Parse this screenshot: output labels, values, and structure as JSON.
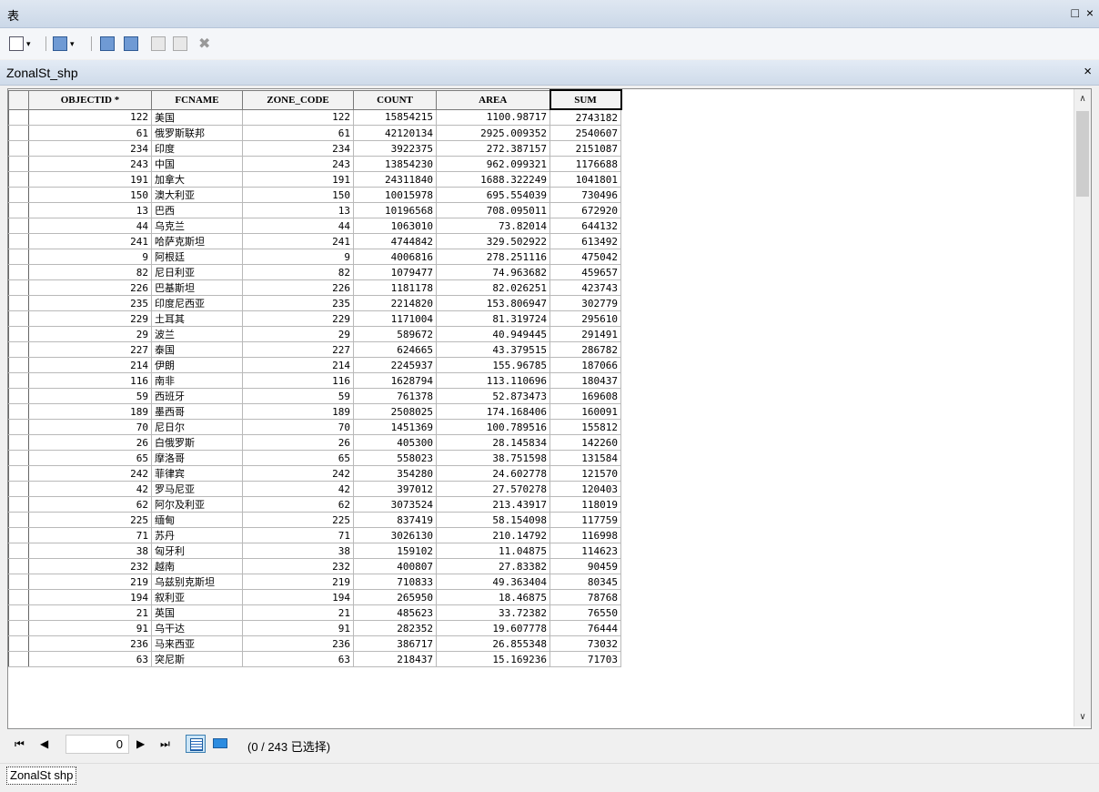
{
  "window": {
    "title": "表",
    "restore_glyph": "□",
    "close_glyph": "×"
  },
  "toolbar": {
    "items": [
      {
        "name": "table-options-icon"
      },
      {
        "name": "related-tables-icon"
      },
      {
        "name": "select-by-attributes-icon"
      },
      {
        "name": "switch-selection-icon"
      },
      {
        "name": "clear-selection-icon"
      },
      {
        "name": "zoom-to-selected-icon"
      },
      {
        "name": "delete-selected-icon"
      }
    ]
  },
  "tab": {
    "title": "ZonalSt_shp",
    "close_glyph": "×"
  },
  "table": {
    "columns": [
      "OBJECTID *",
      "FCNAME",
      "ZONE_CODE",
      "COUNT",
      "AREA",
      "SUM"
    ],
    "rows": [
      [
        "122",
        "美国",
        "122",
        "15854215",
        "1100.98717",
        "2743182"
      ],
      [
        "61",
        "俄罗斯联邦",
        "61",
        "42120134",
        "2925.009352",
        "2540607"
      ],
      [
        "234",
        "印度",
        "234",
        "3922375",
        "272.387157",
        "2151087"
      ],
      [
        "243",
        "中国",
        "243",
        "13854230",
        "962.099321",
        "1176688"
      ],
      [
        "191",
        "加拿大",
        "191",
        "24311840",
        "1688.322249",
        "1041801"
      ],
      [
        "150",
        "澳大利亚",
        "150",
        "10015978",
        "695.554039",
        "730496"
      ],
      [
        "13",
        "巴西",
        "13",
        "10196568",
        "708.095011",
        "672920"
      ],
      [
        "44",
        "乌克兰",
        "44",
        "1063010",
        "73.82014",
        "644132"
      ],
      [
        "241",
        "哈萨克斯坦",
        "241",
        "4744842",
        "329.502922",
        "613492"
      ],
      [
        "9",
        "阿根廷",
        "9",
        "4006816",
        "278.251116",
        "475042"
      ],
      [
        "82",
        "尼日利亚",
        "82",
        "1079477",
        "74.963682",
        "459657"
      ],
      [
        "226",
        "巴基斯坦",
        "226",
        "1181178",
        "82.026251",
        "423743"
      ],
      [
        "235",
        "印度尼西亚",
        "235",
        "2214820",
        "153.806947",
        "302779"
      ],
      [
        "229",
        "土耳其",
        "229",
        "1171004",
        "81.319724",
        "295610"
      ],
      [
        "29",
        "波兰",
        "29",
        "589672",
        "40.949445",
        "291491"
      ],
      [
        "227",
        "泰国",
        "227",
        "624665",
        "43.379515",
        "286782"
      ],
      [
        "214",
        "伊朗",
        "214",
        "2245937",
        "155.96785",
        "187066"
      ],
      [
        "116",
        "南非",
        "116",
        "1628794",
        "113.110696",
        "180437"
      ],
      [
        "59",
        "西班牙",
        "59",
        "761378",
        "52.873473",
        "169608"
      ],
      [
        "189",
        "墨西哥",
        "189",
        "2508025",
        "174.168406",
        "160091"
      ],
      [
        "70",
        "尼日尔",
        "70",
        "1451369",
        "100.789516",
        "155812"
      ],
      [
        "26",
        "白俄罗斯",
        "26",
        "405300",
        "28.145834",
        "142260"
      ],
      [
        "65",
        "摩洛哥",
        "65",
        "558023",
        "38.751598",
        "131584"
      ],
      [
        "242",
        "菲律宾",
        "242",
        "354280",
        "24.602778",
        "121570"
      ],
      [
        "42",
        "罗马尼亚",
        "42",
        "397012",
        "27.570278",
        "120403"
      ],
      [
        "62",
        "阿尔及利亚",
        "62",
        "3073524",
        "213.43917",
        "118019"
      ],
      [
        "225",
        "缅甸",
        "225",
        "837419",
        "58.154098",
        "117759"
      ],
      [
        "71",
        "苏丹",
        "71",
        "3026130",
        "210.14792",
        "116998"
      ],
      [
        "38",
        "匈牙利",
        "38",
        "159102",
        "11.04875",
        "114623"
      ],
      [
        "232",
        "越南",
        "232",
        "400807",
        "27.83382",
        "90459"
      ],
      [
        "219",
        "乌兹别克斯坦",
        "219",
        "710833",
        "49.363404",
        "80345"
      ],
      [
        "194",
        "叙利亚",
        "194",
        "265950",
        "18.46875",
        "78768"
      ],
      [
        "21",
        "英国",
        "21",
        "485623",
        "33.72382",
        "76550"
      ],
      [
        "91",
        "乌干达",
        "91",
        "282352",
        "19.607778",
        "76444"
      ],
      [
        "236",
        "马来西亚",
        "236",
        "386717",
        "26.855348",
        "73032"
      ],
      [
        "63",
        "突尼斯",
        "63",
        "218437",
        "15.169236",
        "71703"
      ]
    ]
  },
  "navigation": {
    "first_glyph": "⏮",
    "prev_glyph": "◀",
    "current_record": "0",
    "next_glyph": "▶",
    "last_glyph": "⏭",
    "selection_info": "(0 / 243 已选择)"
  },
  "status": {
    "tab_label": "ZonalSt shp"
  }
}
